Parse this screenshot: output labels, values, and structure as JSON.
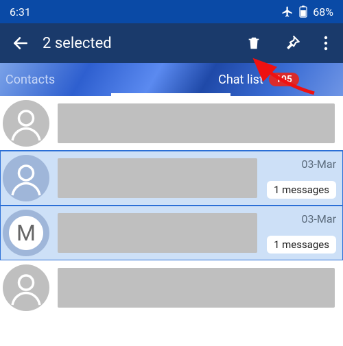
{
  "status": {
    "time": "6:31",
    "battery_pct": "68%"
  },
  "toolbar": {
    "title": "2 selected"
  },
  "tabs": {
    "contacts": "Contacts",
    "chatlist": "Chat list",
    "badge": "105"
  },
  "rows": [
    {
      "selected": false,
      "avatar": "person",
      "letter": "",
      "date": "",
      "count": ""
    },
    {
      "selected": true,
      "avatar": "person",
      "letter": "",
      "date": "03-Mar",
      "count": "1 messages"
    },
    {
      "selected": true,
      "avatar": "letter",
      "letter": "M",
      "date": "03-Mar",
      "count": "1 messages"
    },
    {
      "selected": false,
      "avatar": "person",
      "letter": "",
      "date": "",
      "count": ""
    }
  ]
}
